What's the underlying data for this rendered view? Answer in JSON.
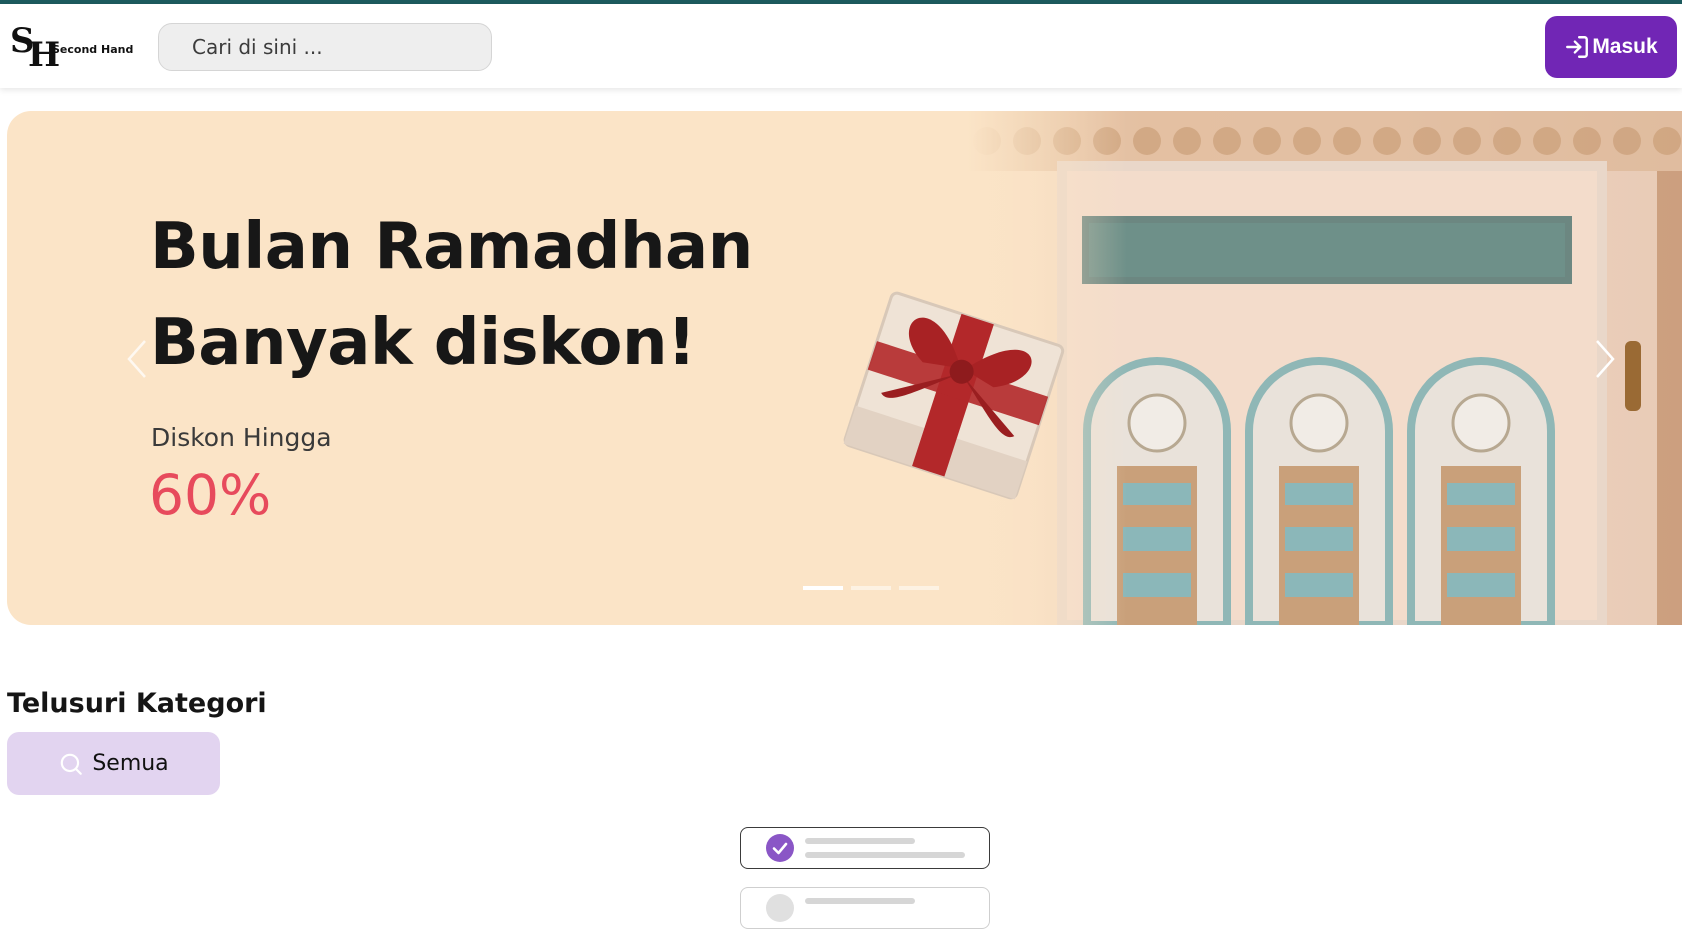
{
  "header": {
    "logo_mark": "SH",
    "logo_s": "S",
    "logo_h": "H",
    "brand": "Second Hand",
    "search_placeholder": "Cari di sini ...",
    "login_label": "Masuk"
  },
  "banner": {
    "headline_line1": "Bulan Ramadhan",
    "headline_line2": "Banyak diskon!",
    "subtitle": "Diskon Hingga",
    "discount": "60%",
    "slide_count": 3,
    "active_slide": 1
  },
  "categories": {
    "title": "Telusuri Kategori",
    "items": [
      {
        "label": "Semua",
        "icon": "search-icon",
        "selected": true
      }
    ]
  },
  "colors": {
    "accent": "#7126b5",
    "category_bg": "#e2d4f0",
    "banner_bg": "#fbe4c7",
    "discount": "#e74a5c",
    "top_line": "#1d5b5e"
  }
}
